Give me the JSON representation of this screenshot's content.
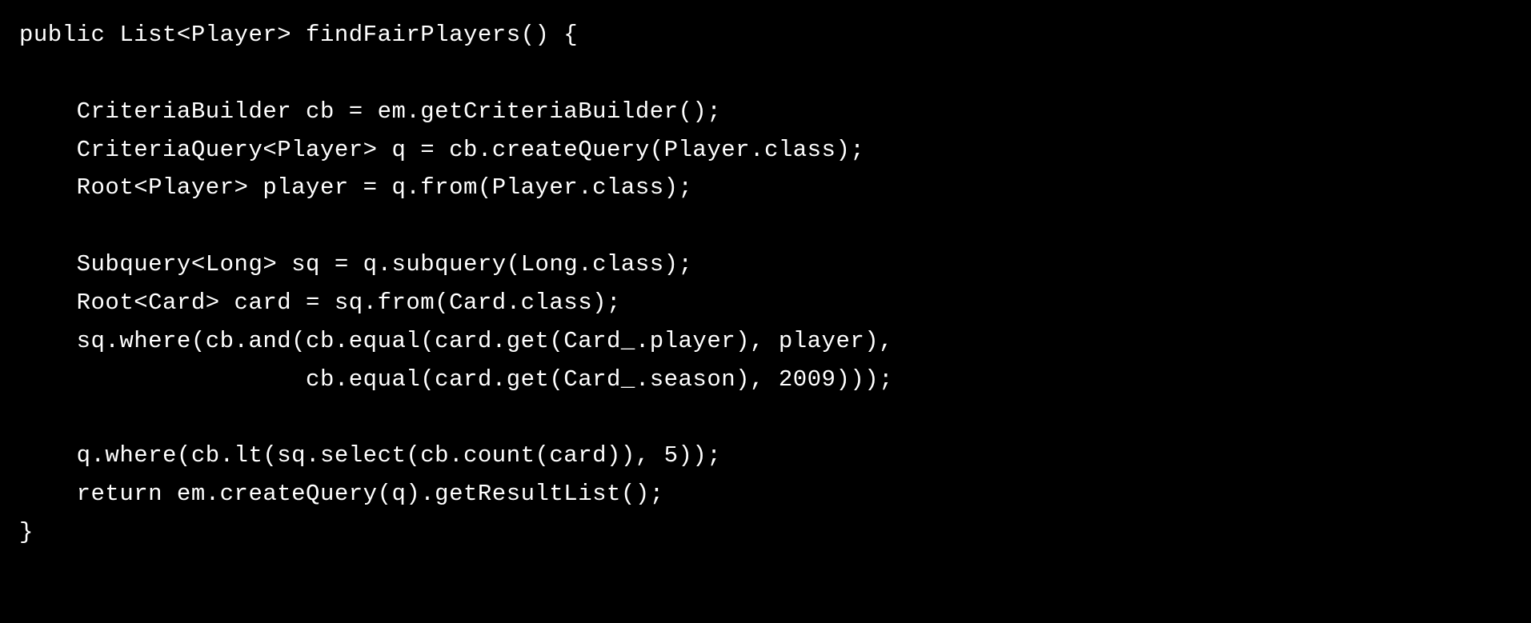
{
  "code": {
    "line1": "public List<Player> findFairPlayers() {",
    "line2": "",
    "line3": "    CriteriaBuilder cb = em.getCriteriaBuilder();",
    "line4": "    CriteriaQuery<Player> q = cb.createQuery(Player.class);",
    "line5": "    Root<Player> player = q.from(Player.class);",
    "line6": "",
    "line7": "    Subquery<Long> sq = q.subquery(Long.class);",
    "line8": "    Root<Card> card = sq.from(Card.class);",
    "line9": "    sq.where(cb.and(cb.equal(card.get(Card_.player), player),",
    "line10": "                    cb.equal(card.get(Card_.season), 2009)));",
    "line11": "",
    "line12": "    q.where(cb.lt(sq.select(cb.count(card)), 5));",
    "line13": "    return em.createQuery(q).getResultList();",
    "line14": "}"
  }
}
